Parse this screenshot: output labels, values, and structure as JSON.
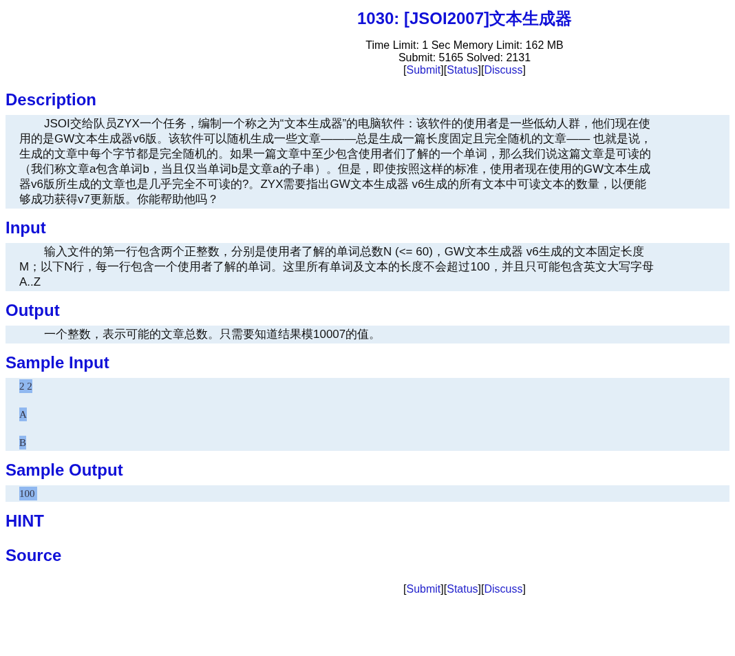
{
  "header": {
    "title": "1030: [JSOI2007]文本生成器",
    "limits": "Time Limit: 1 Sec  Memory Limit: 162 MB",
    "stats": "Submit: 5165  Solved: 2131",
    "links": [
      {
        "kind": "bracket",
        "text": "["
      },
      {
        "kind": "link",
        "text": "Submit"
      },
      {
        "kind": "bracket",
        "text": "]["
      },
      {
        "kind": "link",
        "text": "Status"
      },
      {
        "kind": "bracket",
        "text": "]["
      },
      {
        "kind": "link",
        "text": "Discuss"
      },
      {
        "kind": "bracket",
        "text": "]"
      }
    ]
  },
  "sections": [
    {
      "kind": "text",
      "heading": "Description",
      "body": "JSOI交给队员ZYX一个任务，编制一个称之为“文本生成器”的电脑软件：该软件的使用者是一些低幼人群，他们现在使用的是GW文本生成器v6版。该软件可以随机生成一些文章―――总是生成一篇长度固定且完全随机的文章—— 也就是说，生成的文章中每个字节都是完全随机的。如果一篇文章中至少包含使用者们了解的一个单词，那么我们说这篇文章是可读的（我们称文章a包含单词b，当且仅当单词b是文章a的子串）。但是，即使按照这样的标准，使用者现在使用的GW文本生成器v6版所生成的文章也是几乎完全不可读的?。ZYX需要指出GW文本生成器 v6生成的所有文本中可读文本的数量，以便能够成功获得v7更新版。你能帮助他吗？"
    },
    {
      "kind": "text",
      "heading": "Input",
      "body": "输入文件的第一行包含两个正整数，分别是使用者了解的单词总数N (<= 60)，GW文本生成器 v6生成的文本固定长度M；以下N行，每一行包含一个使用者了解的单词。这里所有单词及文本的长度不会超过100，并且只可能包含英文大写字母A..Z"
    },
    {
      "kind": "text",
      "heading": "Output",
      "body": "一个整数，表示可能的文章总数。只需要知道结果模10007的值。"
    },
    {
      "kind": "code",
      "heading": "Sample Input",
      "lines": [
        "2 2",
        "A",
        "B"
      ],
      "highlighted": true
    },
    {
      "kind": "code",
      "heading": "Sample Output",
      "lines": [
        "100 "
      ],
      "highlighted": true
    },
    {
      "kind": "empty",
      "heading": "HINT"
    },
    {
      "kind": "empty",
      "heading": "Source"
    }
  ],
  "footer_links": [
    {
      "kind": "bracket",
      "text": "["
    },
    {
      "kind": "link",
      "text": "Submit"
    },
    {
      "kind": "bracket",
      "text": "]["
    },
    {
      "kind": "link",
      "text": "Status"
    },
    {
      "kind": "bracket",
      "text": "]["
    },
    {
      "kind": "link",
      "text": "Discuss"
    },
    {
      "kind": "bracket",
      "text": "]"
    }
  ]
}
